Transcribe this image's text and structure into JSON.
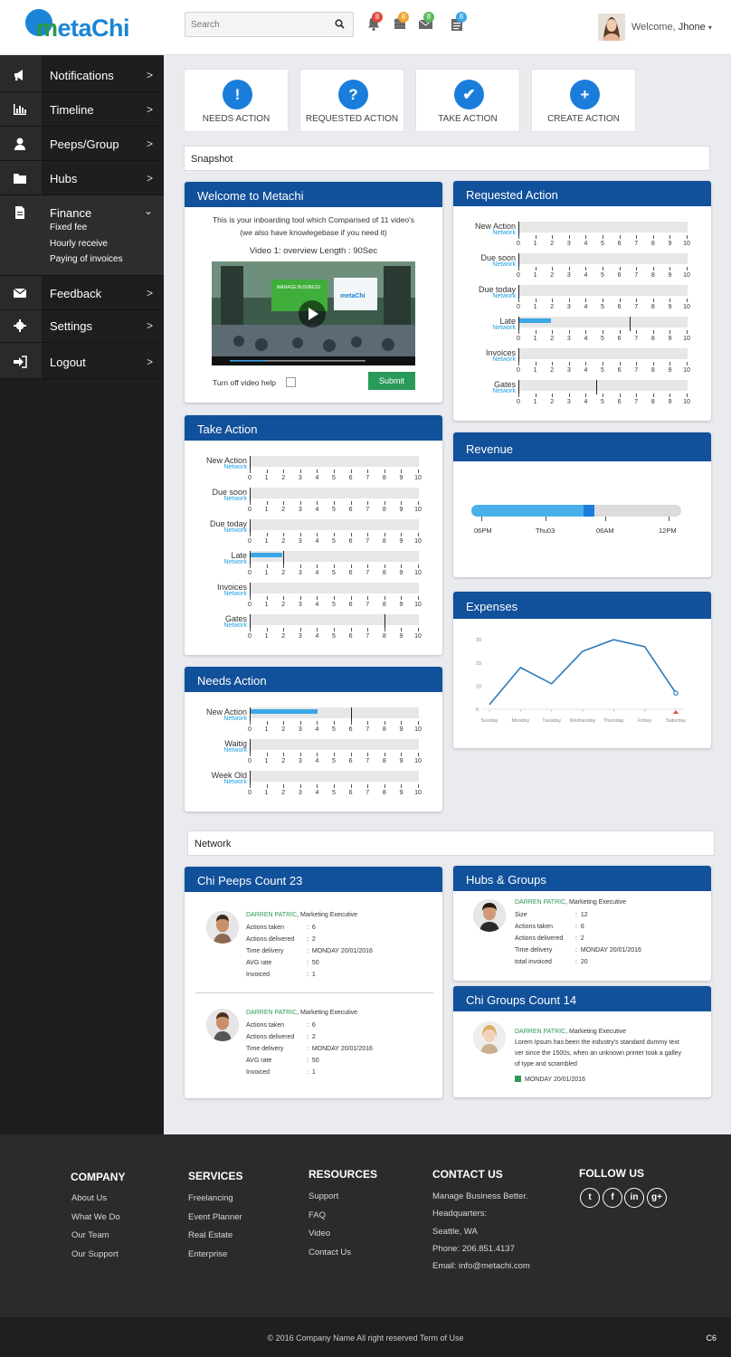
{
  "brand": {
    "logo_text_m": "m",
    "logo_text_rest": "etaChi",
    "accent": "#1a85d6",
    "green": "#2c9b45",
    "header_blue": "#11509a"
  },
  "topbar": {
    "search_placeholder": "Search",
    "notifications": [
      {
        "icon": "bell-icon",
        "count": "8",
        "color": "#e0493c"
      },
      {
        "icon": "coins-icon",
        "count": "8",
        "color": "#f0a630"
      },
      {
        "icon": "envelope-icon",
        "count": "8",
        "color": "#5cb85c"
      },
      {
        "icon": "clipboard-icon",
        "count": "8",
        "color": "#3aa7e6"
      }
    ],
    "welcome": "Welcome,",
    "user": "Jhone"
  },
  "sidebar": {
    "items": [
      {
        "label": "Notifications",
        "icon": "megaphone-icon"
      },
      {
        "label": "Timeline",
        "icon": "bar-chart-icon"
      },
      {
        "label": "Peeps/Group",
        "icon": "user-icon"
      },
      {
        "label": "Hubs",
        "icon": "folder-icon"
      },
      {
        "label": "Finance",
        "icon": "document-icon",
        "sub": [
          "Fixed fee",
          "Hourly receive",
          "Paying of invoices"
        ]
      },
      {
        "label": "Feedback",
        "icon": "envelope-icon"
      },
      {
        "label": "Settings",
        "icon": "gear-icon"
      },
      {
        "label": "Logout",
        "icon": "sign-in-icon"
      }
    ]
  },
  "actions": [
    {
      "label": "NEEDS ACTION",
      "glyph": "!"
    },
    {
      "label": "REQUESTED ACTION",
      "glyph": "?"
    },
    {
      "label": "TAKE ACTION",
      "glyph": "✔"
    },
    {
      "label": "CREATE ACTION",
      "glyph": "+"
    }
  ],
  "snapshot_label": "Snapshot",
  "welcome_card": {
    "title": "Welcome to Metachi",
    "line1": "This is your inboarding tool which Comparised of 11 video's",
    "line2": "(we also have knowlegebase if you need it)",
    "video_title": "Video 1: overview Length : 90Sec",
    "checkbox_label": "Turn off video help",
    "submit_label": "Submit",
    "sign_text1": "MANAGE BUSINESS",
    "sign_text2": "metaChi"
  },
  "axis_ticks": [
    "0",
    "1",
    "2",
    "3",
    "4",
    "5",
    "6",
    "7",
    "8",
    "9",
    "10"
  ],
  "network_sub": "Network",
  "requested_action": {
    "title": "Requested Action",
    "rows": [
      {
        "label": "New Action",
        "fill": 0,
        "marker": null
      },
      {
        "label": "Due soon",
        "fill": 0,
        "marker": null
      },
      {
        "label": "Due today",
        "fill": 0,
        "marker": null
      },
      {
        "label": "Late",
        "fill": 1.9,
        "marker": 6.6
      },
      {
        "label": "Invoices",
        "fill": 0,
        "marker": null
      },
      {
        "label": "Gates",
        "fill": 0,
        "marker": 4.6
      }
    ]
  },
  "take_action": {
    "title": "Take Action",
    "rows": [
      {
        "label": "New Action",
        "fill": 0,
        "marker": null
      },
      {
        "label": "Due soon",
        "fill": 0,
        "marker": null
      },
      {
        "label": "Due today",
        "fill": 0,
        "marker": null
      },
      {
        "label": "Late",
        "fill": 1.9,
        "marker": 2.0
      },
      {
        "label": "Invoices",
        "fill": 0,
        "marker": null
      },
      {
        "label": "Gates",
        "fill": 0,
        "marker": 8.0
      }
    ]
  },
  "needs_action": {
    "title": "Needs Action",
    "rows": [
      {
        "label": "New Action",
        "fill": 4.0,
        "marker": 6.0
      },
      {
        "label": "Waitig",
        "fill": 0,
        "marker": null
      },
      {
        "label": "Week Old",
        "fill": 0,
        "marker": null
      }
    ]
  },
  "revenue": {
    "title": "Revenue",
    "progress": 0.55,
    "labels": [
      "06PM",
      "Thu03",
      "06AM",
      "12PM"
    ]
  },
  "chart_data": {
    "type": "line",
    "title": "Expenses",
    "categories": [
      "Sunday",
      "Monday",
      "Tuesday",
      "Wednesday",
      "Thursday",
      "Friday",
      "Saturday"
    ],
    "x": [
      0,
      0.5,
      1,
      1.5,
      2,
      2.5,
      3,
      3.5,
      4,
      4.5,
      5,
      5.5,
      6
    ],
    "values": [
      2,
      18,
      11,
      25,
      30,
      27,
      7
    ],
    "y_ticks": [
      "0",
      "10",
      "20",
      "30"
    ],
    "ylim": [
      0,
      32
    ],
    "xlabel": "",
    "ylabel": "",
    "line_color": "#2b79b8"
  },
  "network_label": "Network",
  "peeps": {
    "title": "Chi Peeps Count 23",
    "people": [
      {
        "name": "DARREN PATRIC",
        "role": ", Marketing Executive",
        "fields": [
          [
            "Actions taken",
            "6"
          ],
          [
            "Actions delivered",
            "2"
          ],
          [
            "Time delivery",
            "MONDAY  20/01/2016"
          ],
          [
            "AVG rate",
            "50"
          ],
          [
            "Invoiced",
            "1"
          ]
        ]
      },
      {
        "name": "DARREN PATRIC",
        "role": ", Marketing Executive",
        "fields": [
          [
            "Actions taken",
            "6"
          ],
          [
            "Actions delivered",
            "2"
          ],
          [
            "Time delivery",
            "MONDAY  20/01/2016"
          ],
          [
            "AVG rate",
            "50"
          ],
          [
            "Invoiced",
            "1"
          ]
        ]
      }
    ]
  },
  "hubs": {
    "title": "Hubs & Groups",
    "person": {
      "name": "DARREN PATRIC",
      "role": ", Marketing Executive",
      "fields": [
        [
          "Size",
          "12"
        ],
        [
          "Actions taken",
          "6"
        ],
        [
          "Actions delivered",
          "2"
        ],
        [
          "Time delivery",
          "MONDAY  20/01/2016"
        ],
        [
          "total invoiced",
          "20"
        ]
      ]
    }
  },
  "groups": {
    "title": "Chi Groups Count 14",
    "person": {
      "name": "DARREN PATRIC",
      "role": ", Marketing Executive",
      "text1": "Lorem Ipsum has been the industry's standard dummy text",
      "text2": "ver since the 1500s, when an unknown printer took a galley",
      "text3": "of type and scrambled",
      "date": "MONDAY  20/01/2016"
    }
  },
  "footer": {
    "company": {
      "title": "COMPANY",
      "links": [
        "About Us",
        "What We Do",
        "Our Team",
        "Our Support"
      ]
    },
    "services": {
      "title": "SERVICES",
      "links": [
        "Freelancing",
        "Event Planner",
        "Real Estate",
        "Enterprise"
      ]
    },
    "resources": {
      "title": "RESOURCES",
      "links": [
        "Support",
        "FAQ",
        "Video",
        "Contact Us"
      ]
    },
    "contact": {
      "title": "CONTACT US",
      "lines": [
        "Manage Business Better.",
        "Headquarters:",
        "Seattle, WA",
        "Phone: 206.851.4137",
        "Email: info@metachi.com"
      ]
    },
    "follow": {
      "title": "FOLLOW US",
      "icons": [
        "twitter-icon",
        "facebook-icon",
        "linkedin-icon",
        "google-plus-icon"
      ]
    },
    "copyright": "© 2016 Company Name  All right reserved  Term of Use",
    "corner": "C6"
  }
}
